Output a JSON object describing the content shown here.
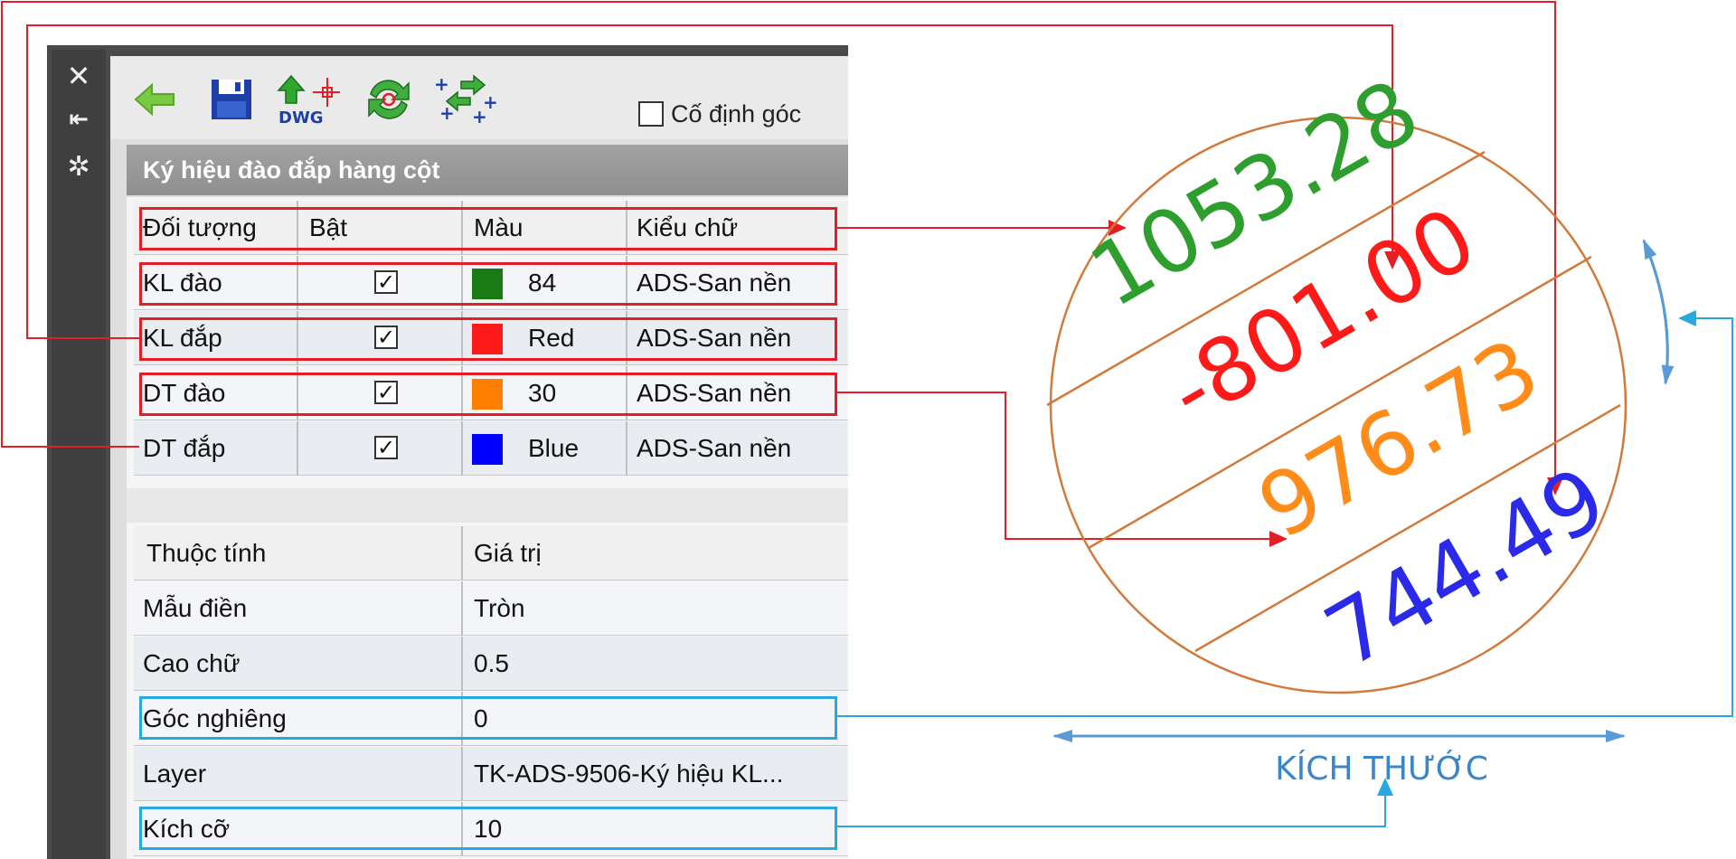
{
  "toolbar": {
    "icons": [
      "back-arrow-icon",
      "save-icon",
      "export-dwg-icon",
      "refresh-icon",
      "move-nodes-icon"
    ],
    "dwg_label": "DWG",
    "fix_angle_label": "Cố định góc"
  },
  "section_title": "Ký hiệu đào đắp hàng cột",
  "objects_table": {
    "headers": [
      "Đối tượng",
      "Bật",
      "Màu",
      "Kiểu chữ"
    ],
    "rows": [
      {
        "object": "KL đào",
        "enabled": "✓",
        "color_hex": "#1a7a14",
        "color": "84",
        "font": "ADS-San nền"
      },
      {
        "object": "KL đắp",
        "enabled": "✓",
        "color_hex": "#ff1a1a",
        "color": "Red",
        "font": "ADS-San nền"
      },
      {
        "object": "DT đào",
        "enabled": "✓",
        "color_hex": "#ff8000",
        "color": "30",
        "font": "ADS-San nền"
      },
      {
        "object": "DT đắp",
        "enabled": "✓",
        "color_hex": "#0000ff",
        "color": "Blue",
        "font": "ADS-San nền"
      }
    ]
  },
  "properties_table": {
    "headers": [
      "Thuộc tính",
      "Giá trị"
    ],
    "rows": [
      {
        "name": "Mẫu điền",
        "value": "Tròn"
      },
      {
        "name": "Cao chữ",
        "value": "0.5"
      },
      {
        "name": "Góc nghiêng",
        "value": "0"
      },
      {
        "name": "Layer",
        "value": "TK-ADS-9506-Ký hiệu KL..."
      },
      {
        "name": "Kích cỡ",
        "value": "10"
      }
    ]
  },
  "symbol": {
    "values": [
      "1053.28",
      "-801.00",
      "976.73",
      "744.49"
    ],
    "size_label": "KÍCH THƯỚC"
  },
  "colors": {
    "callout_red": "#e31e24",
    "callout_blue": "#29a8e0",
    "circle": "#d27a3c",
    "dimension": "#5b9bd5"
  }
}
